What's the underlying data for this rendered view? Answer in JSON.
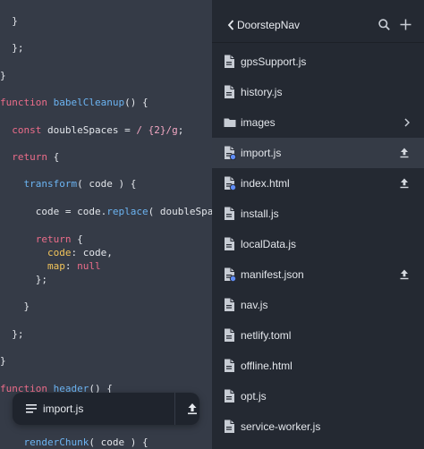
{
  "editor": {
    "lines": [
      [
        {
          "t": "  }"
        }
      ],
      [
        {
          "t": "  };"
        }
      ],
      [
        {
          "t": "}"
        }
      ],
      [
        {
          "t": "function ",
          "c": "kw"
        },
        {
          "t": "babelCleanup",
          "c": "fn"
        },
        {
          "t": "() {"
        }
      ],
      [
        {
          "t": "  const ",
          "c": "kw"
        },
        {
          "t": "doubleSpaces = "
        },
        {
          "t": "/ {2}/g",
          "c": "str"
        },
        {
          "t": ";"
        }
      ],
      [
        {
          "t": "  return ",
          "c": "kw"
        },
        {
          "t": "{"
        }
      ],
      [
        {
          "t": "    transform",
          "c": "fn"
        },
        {
          "t": "( code ) {"
        }
      ],
      [
        {
          "t": "      code = code."
        },
        {
          "t": "replace",
          "c": "fn"
        },
        {
          "t": "( doubleSpaces"
        }
      ],
      [
        {
          "t": "      return ",
          "c": "kw"
        },
        {
          "t": "{"
        }
      ],
      [
        {
          "t": "        code",
          "c": "prop"
        },
        {
          "t": ": code,"
        }
      ],
      [
        {
          "t": "        map",
          "c": "prop"
        },
        {
          "t": ": "
        },
        {
          "t": "null",
          "c": "val"
        }
      ],
      [
        {
          "t": "      };"
        }
      ],
      [
        {
          "t": "    }"
        }
      ],
      [
        {
          "t": "  };"
        }
      ],
      [
        {
          "t": "}"
        }
      ],
      [
        {
          "t": "function ",
          "c": "kw"
        },
        {
          "t": "header",
          "c": "fn"
        },
        {
          "t": "() {"
        }
      ],
      [
        {
          "t": "    renderChunk",
          "c": "fn"
        },
        {
          "t": "( code ) {"
        }
      ]
    ]
  },
  "open_file": {
    "name": "import.js",
    "menu_icon": "hamburger-menu-icon",
    "upload_icon": "upload-icon"
  },
  "panel": {
    "title": "DoorstepNav",
    "back_icon": "chevron-left-icon",
    "search_icon": "search-icon",
    "add_icon": "plus-icon",
    "items": [
      {
        "name": "gpsSupport.js",
        "type": "file",
        "modified": false,
        "upload": false,
        "selected": false
      },
      {
        "name": "history.js",
        "type": "file",
        "modified": false,
        "upload": false,
        "selected": false
      },
      {
        "name": "images",
        "type": "folder",
        "modified": false,
        "upload": false,
        "selected": false
      },
      {
        "name": "import.js",
        "type": "file",
        "modified": true,
        "upload": true,
        "selected": true
      },
      {
        "name": "index.html",
        "type": "file",
        "modified": true,
        "upload": true,
        "selected": false
      },
      {
        "name": "install.js",
        "type": "file",
        "modified": false,
        "upload": false,
        "selected": false
      },
      {
        "name": "localData.js",
        "type": "file",
        "modified": false,
        "upload": false,
        "selected": false
      },
      {
        "name": "manifest.json",
        "type": "file",
        "modified": true,
        "upload": true,
        "selected": false
      },
      {
        "name": "nav.js",
        "type": "file",
        "modified": false,
        "upload": false,
        "selected": false
      },
      {
        "name": "netlify.toml",
        "type": "file",
        "modified": false,
        "upload": false,
        "selected": false
      },
      {
        "name": "offline.html",
        "type": "file",
        "modified": false,
        "upload": false,
        "selected": false
      },
      {
        "name": "opt.js",
        "type": "file",
        "modified": false,
        "upload": false,
        "selected": false
      },
      {
        "name": "service-worker.js",
        "type": "file",
        "modified": false,
        "upload": false,
        "selected": false
      }
    ]
  },
  "colors": {
    "editor_bg": "#353b47",
    "panel_bg": "#242932",
    "selected_row": "#353b46",
    "keyword": "#ec6d8a",
    "function": "#6cb4f2",
    "property": "#f2c45a",
    "modified_dot": "#5f8cf5"
  }
}
